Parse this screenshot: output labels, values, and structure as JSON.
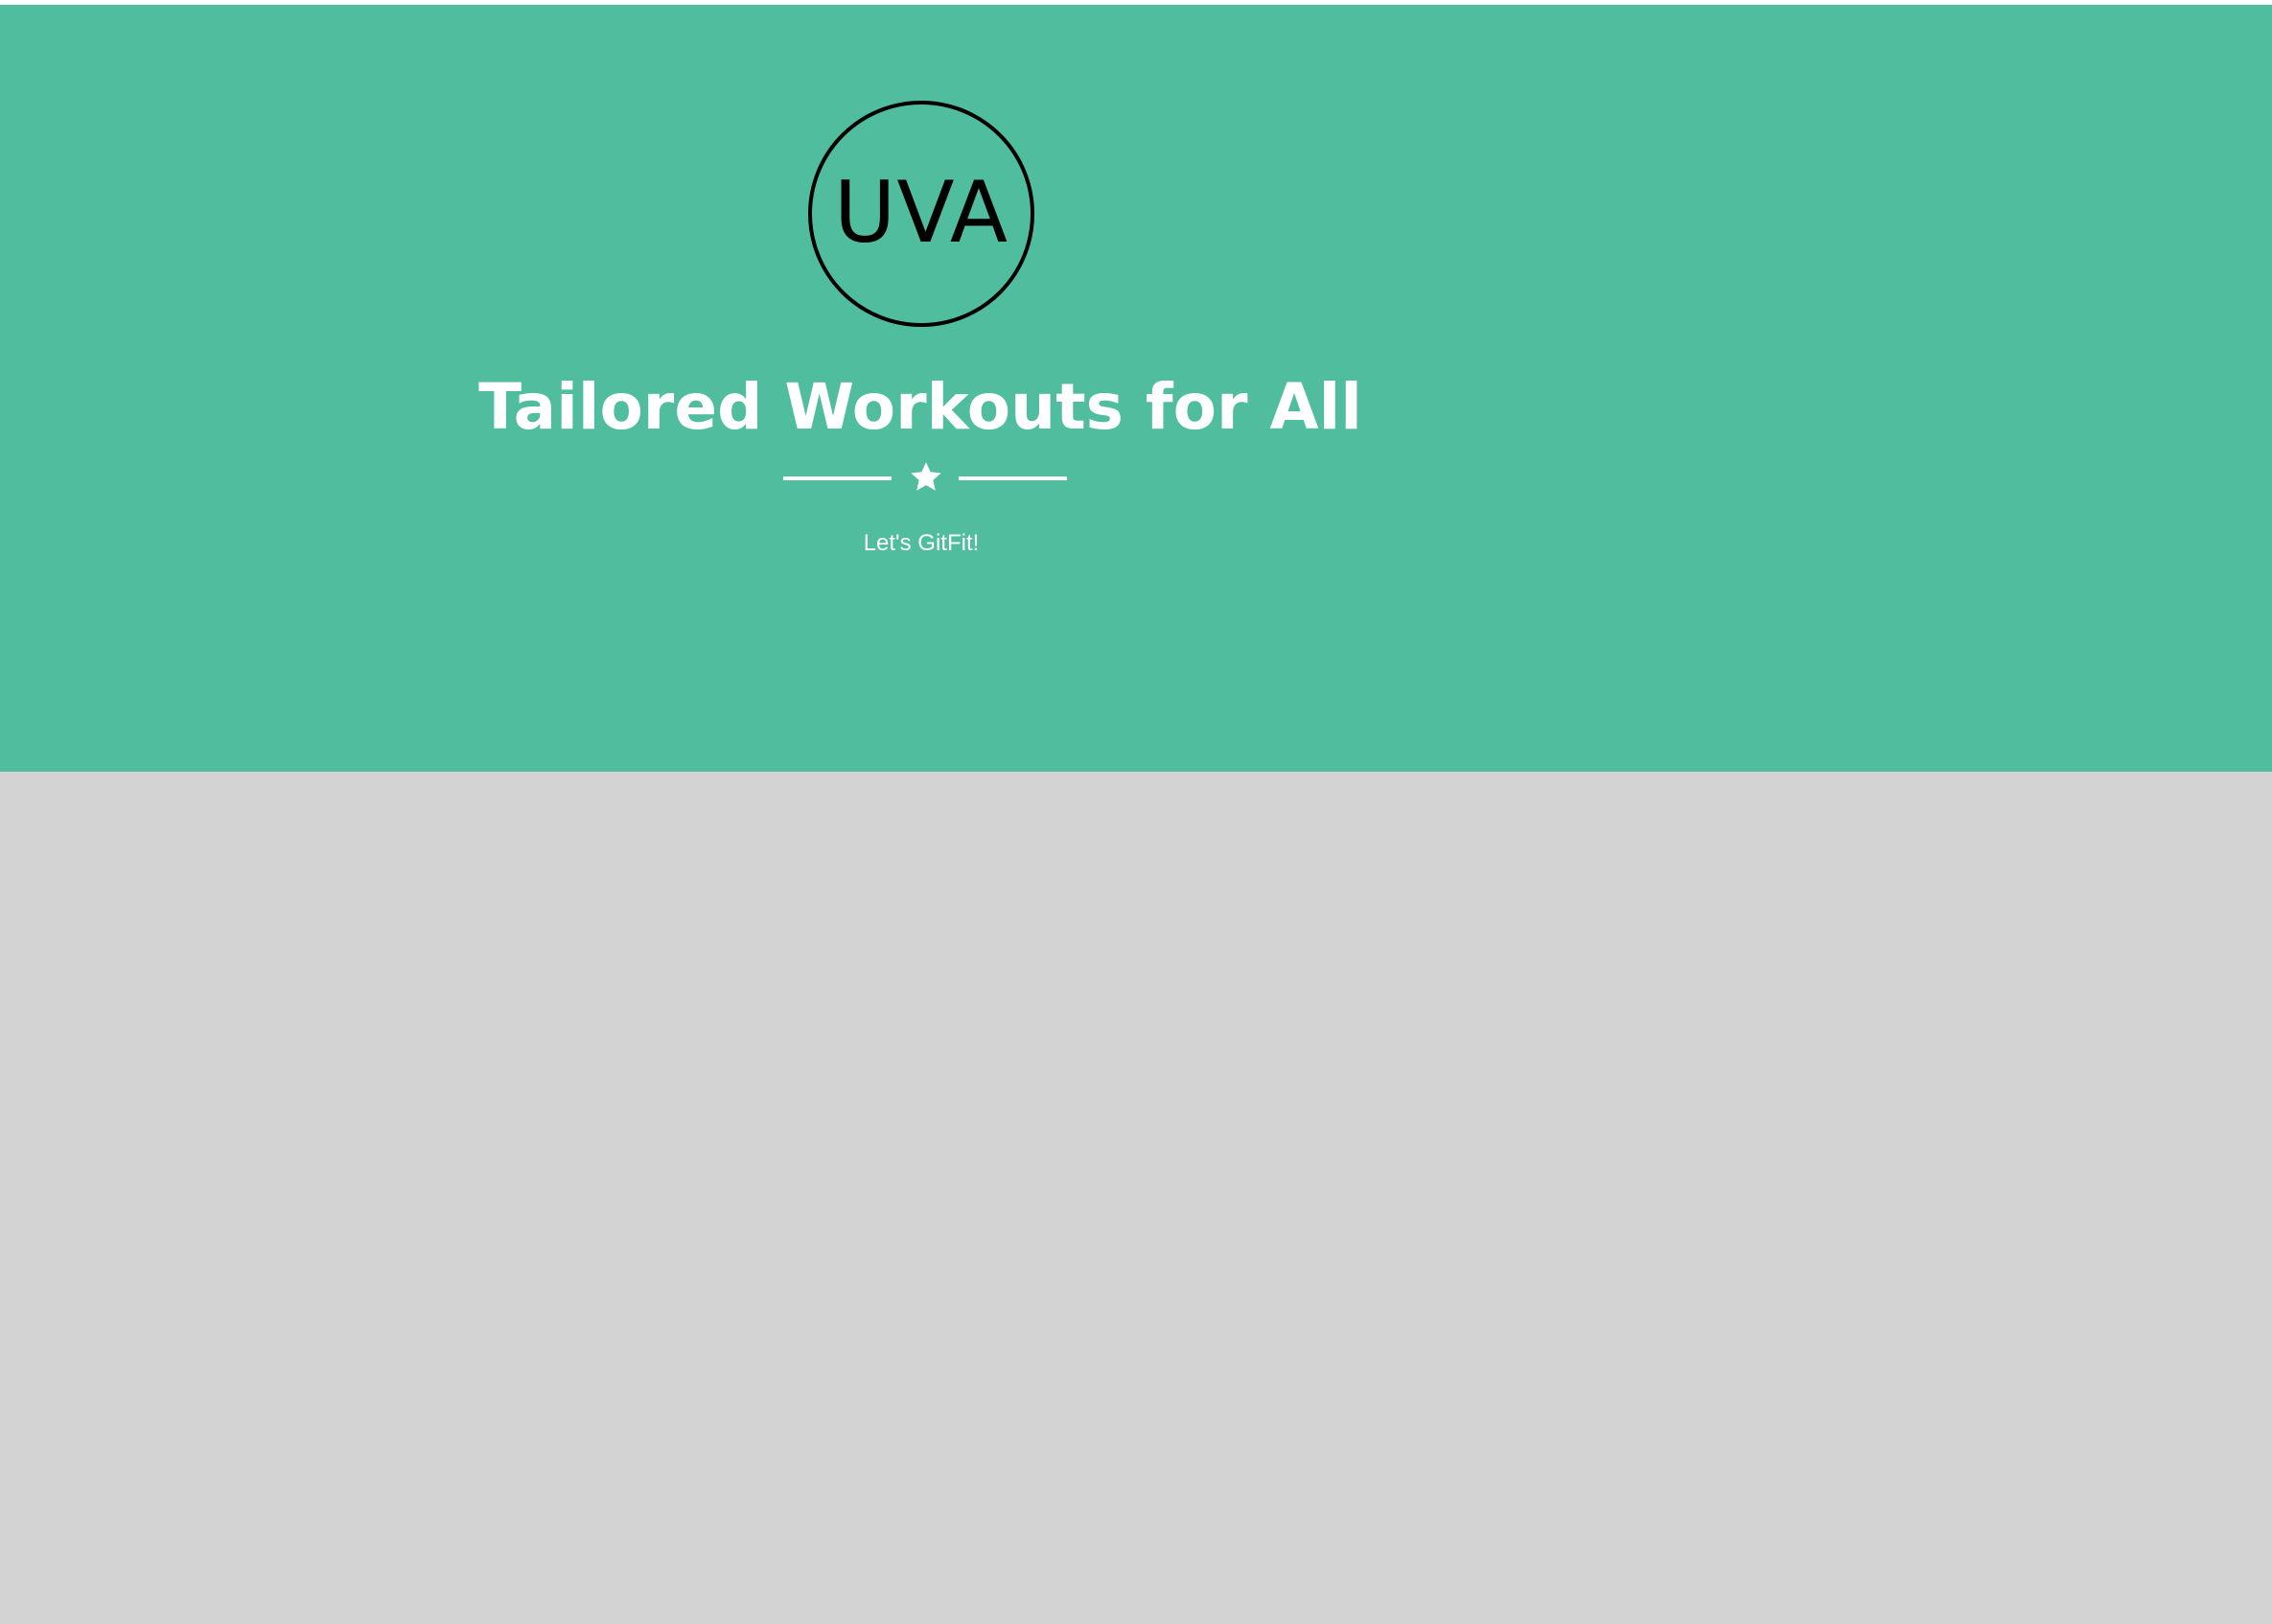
{
  "colors": {
    "hero_background": "#50bd9f",
    "lower_background": "#d3d3d3",
    "hero_text": "#ffffff",
    "logo_ink": "#000000"
  },
  "hero": {
    "logo_text": "UVA",
    "title": "Tailored Workouts for All",
    "divider_icon": "star-icon",
    "subtitle": "Let's GitFit!"
  }
}
